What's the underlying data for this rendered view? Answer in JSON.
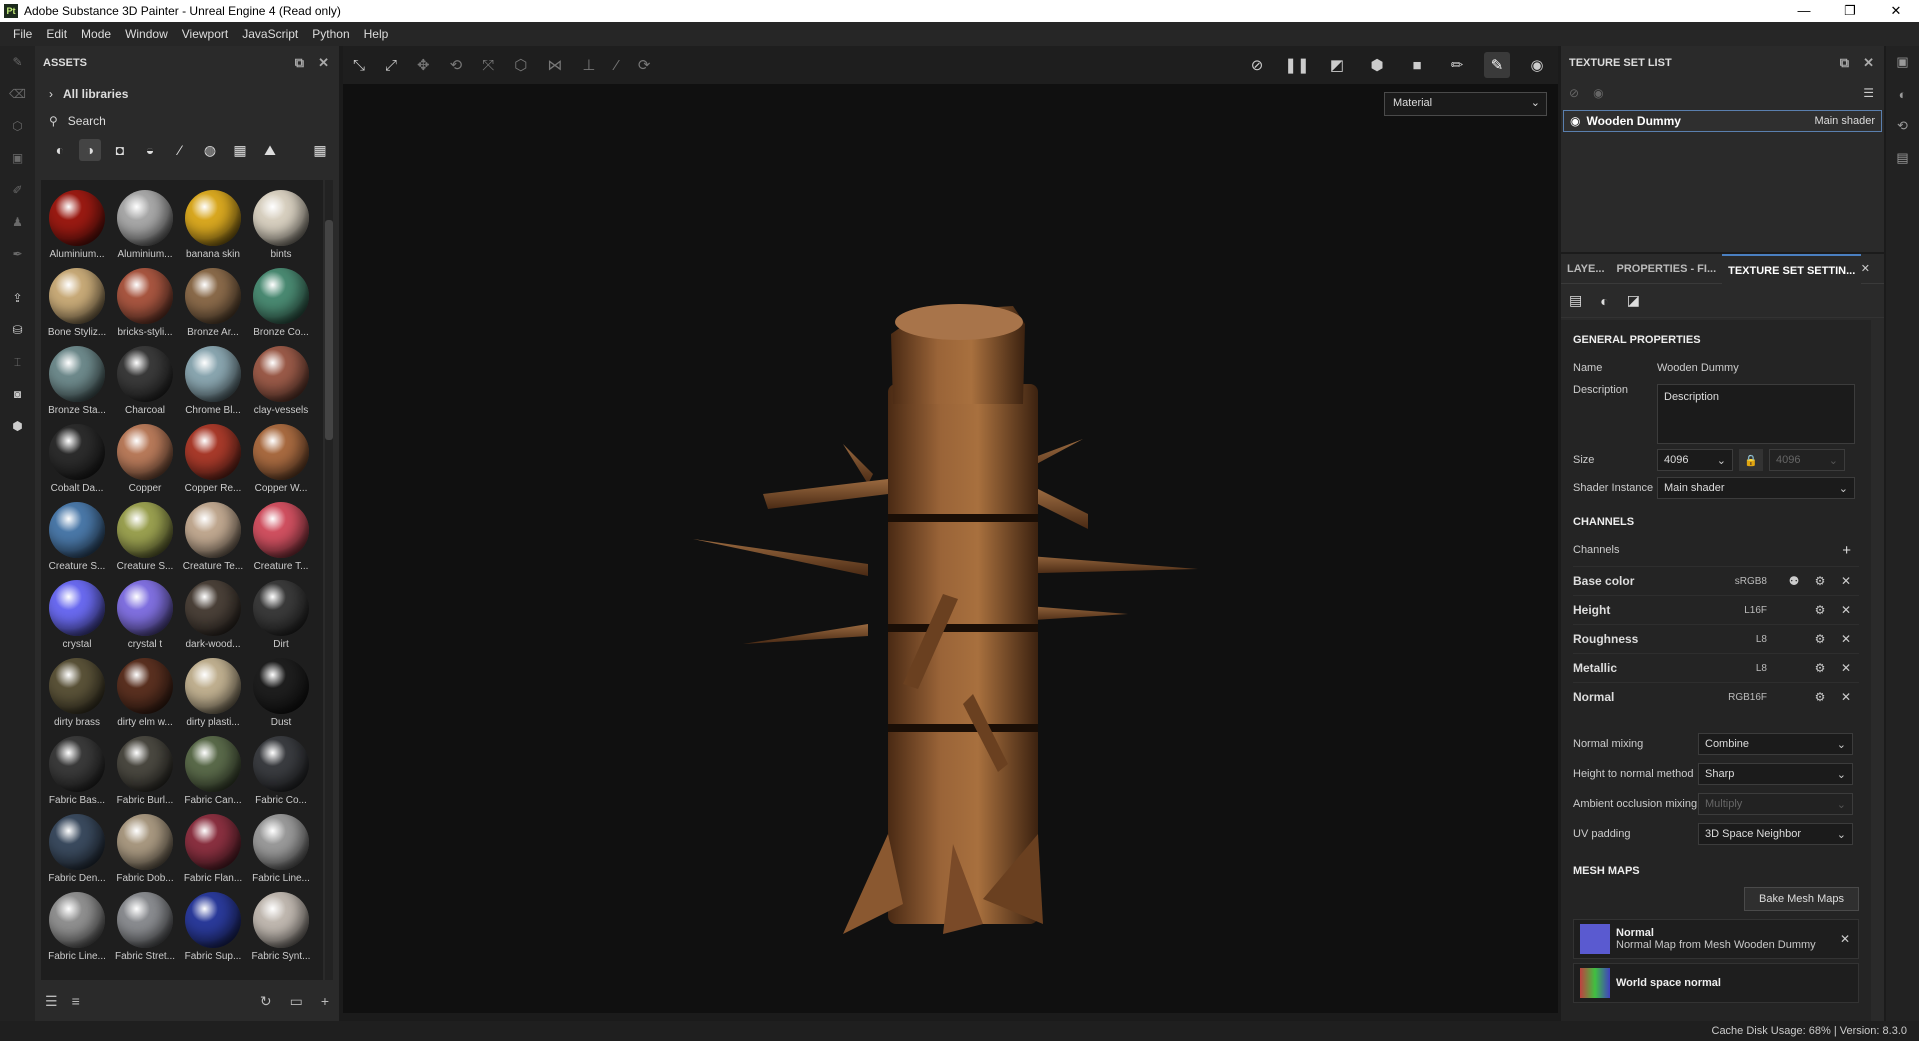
{
  "titlebar": {
    "icon": "Pt",
    "title": "Adobe Substance 3D Painter - Unreal Engine 4 (Read only)",
    "minimize": "—",
    "maximize": "❐",
    "close": "✕"
  },
  "menu": [
    "File",
    "Edit",
    "Mode",
    "Window",
    "Viewport",
    "JavaScript",
    "Python",
    "Help"
  ],
  "assets": {
    "title": "ASSETS",
    "libraries": "All libraries",
    "search_placeholder": "Search",
    "items": [
      "Aluminium...",
      "Aluminium...",
      "banana skin",
      "bints",
      "Bone Styliz...",
      "bricks-styli...",
      "Bronze Ar...",
      "Bronze Co...",
      "Bronze Sta...",
      "Charcoal",
      "Chrome Bl...",
      "clay-vessels",
      "Cobalt Da...",
      "Copper",
      "Copper Re...",
      "Copper W...",
      "Creature S...",
      "Creature S...",
      "Creature Te...",
      "Creature T...",
      "crystal",
      "crystal t",
      "dark-wood...",
      "Dirt",
      "dirty brass",
      "dirty elm w...",
      "dirty plasti...",
      "Dust",
      "Fabric Bas...",
      "Fabric Burl...",
      "Fabric Can...",
      "Fabric Co...",
      "Fabric Den...",
      "Fabric Dob...",
      "Fabric Flan...",
      "Fabric Line...",
      "Fabric Line...",
      "Fabric Stret...",
      "Fabric Sup...",
      "Fabric Synt..."
    ],
    "colors": [
      "#9a1a12",
      "#a8a8a8",
      "#d9a820",
      "#d8d0c0",
      "#c8aa78",
      "#a85640",
      "#8a6a4a",
      "#4a8a72",
      "#6e8a8c",
      "#3a3a3a",
      "#8aa6b0",
      "#9a5a48",
      "#2c2c2c",
      "#b87a5a",
      "#a83a2a",
      "#a86a40",
      "#4a78a8",
      "#9aa050",
      "#c0a890",
      "#d05060",
      "#6a6af0",
      "#8070e0",
      "#4a4038",
      "#3a3a3a",
      "#5a5238",
      "#5a3020",
      "#c0b090",
      "#1e1e1e",
      "#3a3a3a",
      "#4a4840",
      "#5a6a4a",
      "#3a3c40",
      "#3a4a5e",
      "#a89880",
      "#8a3040",
      "#9a9a9a",
      "#909090",
      "#8a8c90",
      "#2a3a9a",
      "#c0b8b0"
    ]
  },
  "viewport": {
    "mode_select": "Material"
  },
  "texture_set_list": {
    "title": "TEXTURE SET LIST",
    "set_name": "Wooden Dummy",
    "shader": "Main shader"
  },
  "tss": {
    "tabs": [
      "LAYE...",
      "PROPERTIES - FI...",
      "TEXTURE SET SETTIN..."
    ],
    "general_title": "GENERAL PROPERTIES",
    "name_label": "Name",
    "name_value": "Wooden Dummy",
    "desc_label": "Description",
    "desc_value": "Description",
    "size_label": "Size",
    "size_value": "4096",
    "size_value2": "4096",
    "shader_label": "Shader Instance",
    "shader_value": "Main shader",
    "channels_title": "CHANNELS",
    "channels_label": "Channels",
    "channels": [
      {
        "name": "Base color",
        "format": "sRGB8"
      },
      {
        "name": "Height",
        "format": "L16F"
      },
      {
        "name": "Roughness",
        "format": "L8"
      },
      {
        "name": "Metallic",
        "format": "L8"
      },
      {
        "name": "Normal",
        "format": "RGB16F"
      }
    ],
    "normal_mixing_label": "Normal mixing",
    "normal_mixing": "Combine",
    "h2n_label": "Height to normal method",
    "h2n": "Sharp",
    "ao_label": "Ambient occlusion mixing",
    "ao": "Multiply",
    "uv_label": "UV padding",
    "uv": "3D Space Neighbor",
    "mesh_title": "MESH MAPS",
    "bake_label": "Bake Mesh Maps",
    "mesh_maps": [
      {
        "name": "Normal",
        "desc": "Normal Map from Mesh Wooden Dummy"
      },
      {
        "name": "World space normal",
        "desc": ""
      }
    ]
  },
  "status": {
    "cache": "Cache Disk Usage:",
    "cache_value": "68%",
    "version": "| Version: 8.3.0"
  }
}
